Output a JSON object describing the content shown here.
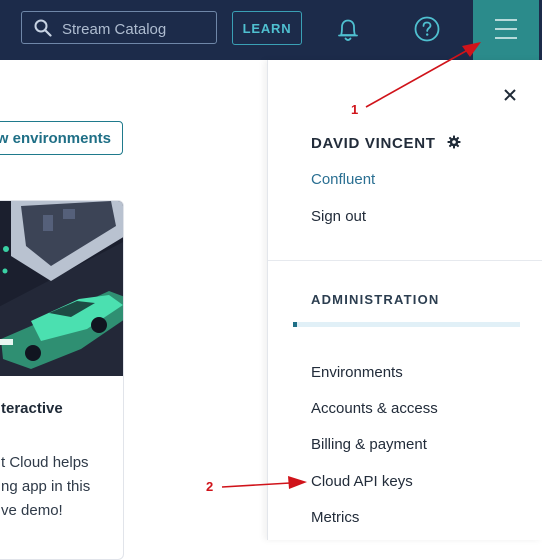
{
  "topbar": {
    "search": {
      "placeholder": "Stream Catalog",
      "icon": "search-icon"
    },
    "learn_label": "LEARN",
    "icons": {
      "notifications": "bell-icon",
      "help": "help-icon",
      "menu": "hamburger-icon"
    },
    "colors": {
      "bar": "#1c2b4a",
      "menu_active": "#2b8b8b",
      "accent": "#4fc0d0"
    }
  },
  "background": {
    "environments_button": "w environments",
    "card": {
      "title": "teractive",
      "lines": [
        "t Cloud helps",
        "ng app in this",
        "ve demo!"
      ]
    }
  },
  "account_menu": {
    "close_icon": "close-icon",
    "user_name": "DAVID VINCENT",
    "settings_icon": "gear-icon",
    "organization": "Confluent",
    "sign_out": "Sign out",
    "section_title": "ADMINISTRATION",
    "items": [
      {
        "label": "Environments"
      },
      {
        "label": "Accounts & access"
      },
      {
        "label": "Billing & payment"
      },
      {
        "label": "Cloud API keys"
      },
      {
        "label": "Metrics"
      }
    ]
  },
  "annotations": [
    {
      "label": "1",
      "color": "#d0131a"
    },
    {
      "label": "2",
      "color": "#d0131a"
    }
  ]
}
